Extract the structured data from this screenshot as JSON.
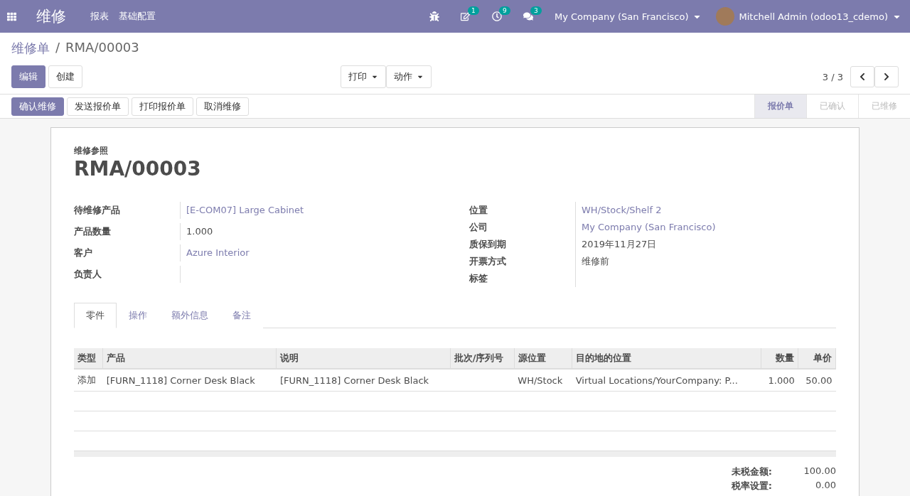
{
  "navbar": {
    "app_title": "维修",
    "menu": [
      "报表",
      "基础配置"
    ],
    "badges": [
      {
        "kind": "edit",
        "count": "1"
      },
      {
        "kind": "activity",
        "count": "9"
      },
      {
        "kind": "chat",
        "count": "3"
      }
    ],
    "company": "My Company (San Francisco)",
    "user": "Mitchell Admin (odoo13_cdemo)"
  },
  "breadcrumb": {
    "parent": "维修单",
    "separator": "/",
    "current": "RMA/00003"
  },
  "buttons": {
    "primary": "编辑",
    "secondary": "创建"
  },
  "dropdowns": [
    "打印",
    "动作"
  ],
  "pager": "3 / 3",
  "actions": [
    {
      "label": "确认维修",
      "primary": true
    },
    {
      "label": "发送报价单",
      "primary": false
    },
    {
      "label": "打印报价单",
      "primary": false
    },
    {
      "label": "取消维修",
      "primary": false
    }
  ],
  "statusbar": [
    {
      "label": "报价单",
      "selected": true
    },
    {
      "label": "已确认",
      "selected": false
    },
    {
      "label": "已维修",
      "selected": false
    }
  ],
  "form": {
    "ref_label": "维修参照",
    "ref": "RMA/00003",
    "left_fields": [
      {
        "label": "待维修产品",
        "value": "[E-COM07] Large Cabinet",
        "link": true
      },
      {
        "label": "产品数量",
        "value": "1.000",
        "link": false
      },
      {
        "label": "客户",
        "value": "Azure Interior",
        "link": true
      },
      {
        "label": "负责人"
      }
    ],
    "right_fields": [
      {
        "label": "位置",
        "value": "WH/Stock/Shelf 2",
        "link": true
      },
      {
        "label": "公司",
        "value": "My Company (San Francisco)",
        "link": true
      },
      {
        "label": "质保到期",
        "value": "2019年11月27日",
        "link": false
      },
      {
        "label": "开票方式",
        "value": "维修前",
        "link": false
      },
      {
        "label": "标签"
      }
    ]
  },
  "tabs": [
    {
      "label": "零件",
      "selected": true
    },
    {
      "label": "操作",
      "selected": false
    },
    {
      "label": "额外信息",
      "selected": false
    },
    {
      "label": "备注",
      "selected": false
    }
  ],
  "table": {
    "columns": [
      "类型",
      "产品",
      "说明",
      "批次/序列号",
      "源位置",
      "目的地的位置",
      "数量",
      "单价"
    ],
    "rows": [
      [
        "添加",
        "[FURN_1118] Corner Desk Black",
        "[FURN_1118] Corner Desk Black",
        "",
        "WH/Stock",
        "Virtual Locations/YourCompany: P...",
        "1.000",
        "50.00"
      ]
    ]
  },
  "totals": [
    {
      "label": "未税金额:",
      "value": "100.00"
    },
    {
      "label": "税率设置:",
      "value": "0.00"
    }
  ]
}
